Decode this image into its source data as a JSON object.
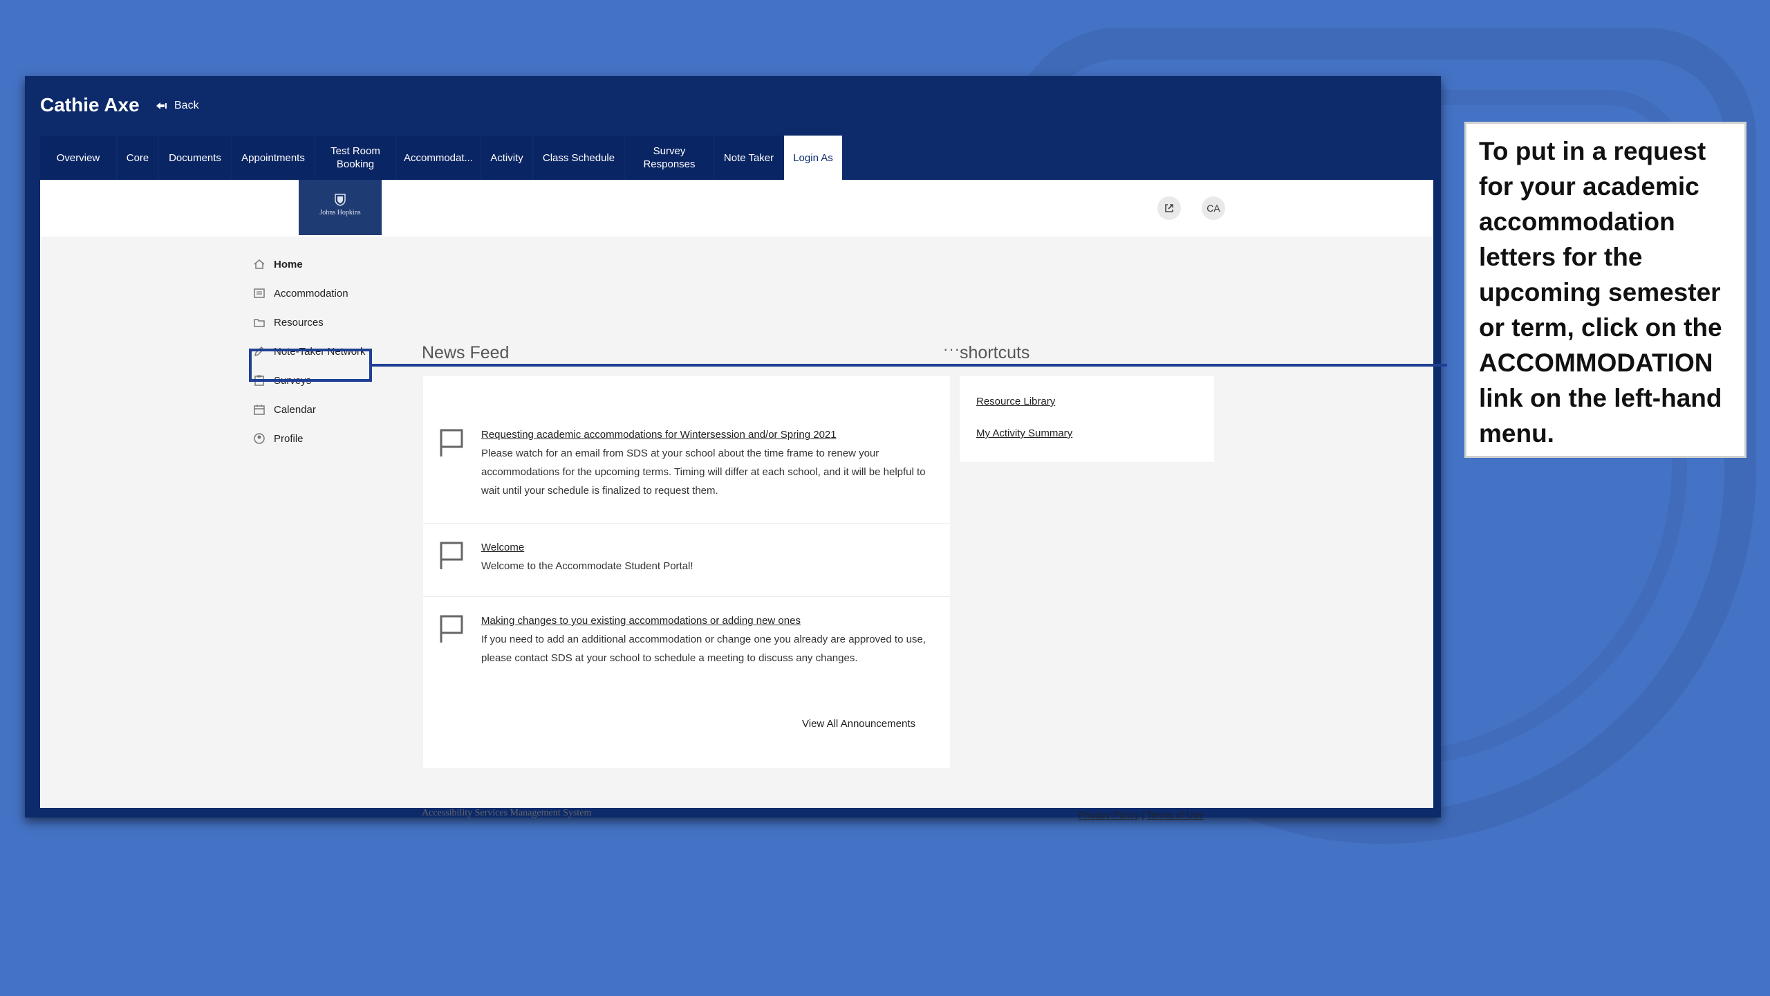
{
  "window": {
    "user_name": "Cathie Axe",
    "back_label": "Back"
  },
  "tabs": [
    {
      "label": "Overview"
    },
    {
      "label": "Core"
    },
    {
      "label": "Documents"
    },
    {
      "label": "Appointments"
    },
    {
      "label": "Test Room\nBooking"
    },
    {
      "label": "Accommodat..."
    },
    {
      "label": "Activity"
    },
    {
      "label": "Class Schedule"
    },
    {
      "label": "Survey\nResponses"
    },
    {
      "label": "Note Taker"
    },
    {
      "label": "Login As",
      "active": true
    }
  ],
  "header": {
    "logo_text": "Johns Hopkins",
    "open_icon": "external-link-icon",
    "avatar_initials": "CA"
  },
  "sidebar": {
    "items": [
      {
        "label": "Home",
        "icon": "home-icon"
      },
      {
        "label": "Accommodation",
        "icon": "list-icon"
      },
      {
        "label": "Resources",
        "icon": "folder-icon"
      },
      {
        "label": "Note-Taker Network",
        "icon": "pencil-icon"
      },
      {
        "label": "Surveys",
        "icon": "clipboard-icon"
      },
      {
        "label": "Calendar",
        "icon": "calendar-icon"
      },
      {
        "label": "Profile",
        "icon": "user-icon"
      }
    ]
  },
  "news_feed": {
    "title": "News Feed",
    "items": [
      {
        "title": "Requesting academic accommodations for Wintersession and/or Spring 2021",
        "body": "Please watch for an email from SDS at your school about the time frame to renew your accommodations for the upcoming terms. Timing will differ at each school, and it will be helpful to wait until your schedule is finalized to request them."
      },
      {
        "title": "Welcome",
        "body": "Welcome to the Accommodate Student Portal!"
      },
      {
        "title": "Making changes to you existing accommodations or adding new ones",
        "body": "If you need to add an additional accommodation or change one you already are approved to use, please contact SDS at your school to schedule a meeting to discuss any changes."
      }
    ],
    "view_all": "View All Announcements"
  },
  "shortcuts": {
    "title": "shortcuts",
    "links": [
      "Resource Library",
      "My Activity Summary"
    ]
  },
  "footer": {
    "system_name": "Accessibility Services Management System",
    "privacy": "Privacy Policy",
    "separator": "|",
    "terms": "Terms of Use"
  },
  "callout": {
    "text": "To put in a request for your academic accommodation letters for the upcoming semester or term, click on the ACCOMMODATION link on the left-hand menu."
  },
  "colors": {
    "background": "#4472c4",
    "nav_dark": "#0d2a6b",
    "highlight": "#1f3f94"
  }
}
